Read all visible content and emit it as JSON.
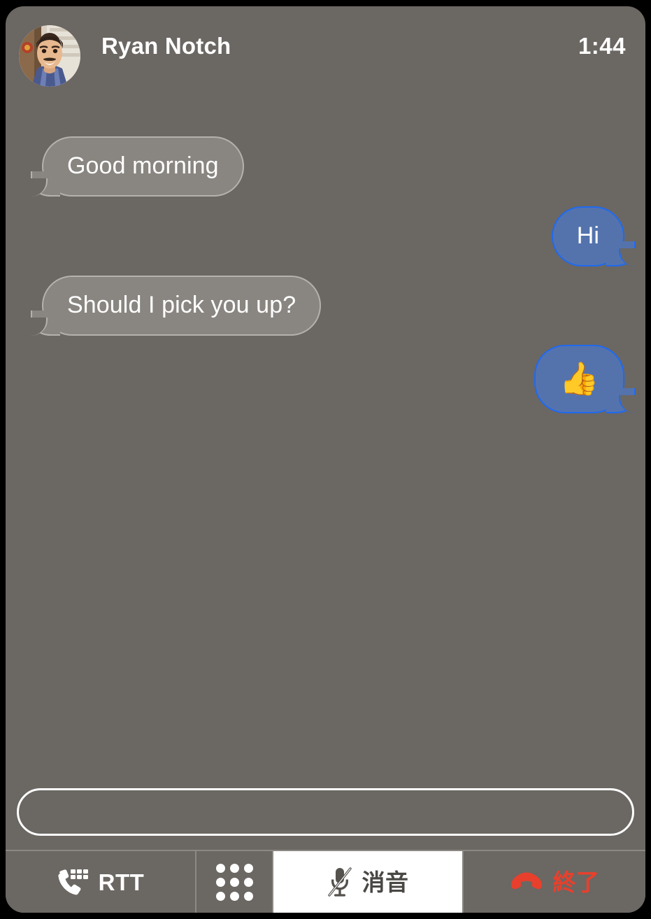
{
  "header": {
    "caller_name": "Ryan Notch",
    "call_timer": "1:44",
    "avatar_icon": "contact-photo-avatar"
  },
  "transcript": {
    "messages": [
      {
        "id": "msg-1",
        "direction": "incoming",
        "text": "Good morning",
        "kind": "text"
      },
      {
        "id": "msg-2",
        "direction": "outgoing",
        "text": "Hi",
        "kind": "text"
      },
      {
        "id": "msg-3",
        "direction": "incoming",
        "text": "Should I pick you up?",
        "kind": "text"
      },
      {
        "id": "msg-4",
        "direction": "outgoing",
        "text": "👍",
        "kind": "emoji"
      }
    ]
  },
  "compose": {
    "value": "",
    "placeholder": ""
  },
  "toolbar": {
    "rtt": {
      "label": "RTT",
      "icon": "phone-keyboard-icon",
      "active": false
    },
    "keypad": {
      "label": "",
      "icon": "keypad-dots-icon",
      "active": false
    },
    "mute": {
      "label": "消音",
      "icon": "microphone-muted-icon",
      "active": true
    },
    "end": {
      "label": "終了",
      "icon": "end-call-phone-icon",
      "active": false
    }
  },
  "colors": {
    "panel_background": "#6b6763",
    "incoming_bubble_fill": "#898681",
    "incoming_bubble_border": "#b5b2ad",
    "outgoing_bubble_fill": "#5473ad",
    "outgoing_bubble_border": "#1f6af0",
    "end_call_red": "#e8402c",
    "mute_active_background": "#ffffff",
    "divider": "#8c8984",
    "text_primary": "#ffffff"
  }
}
